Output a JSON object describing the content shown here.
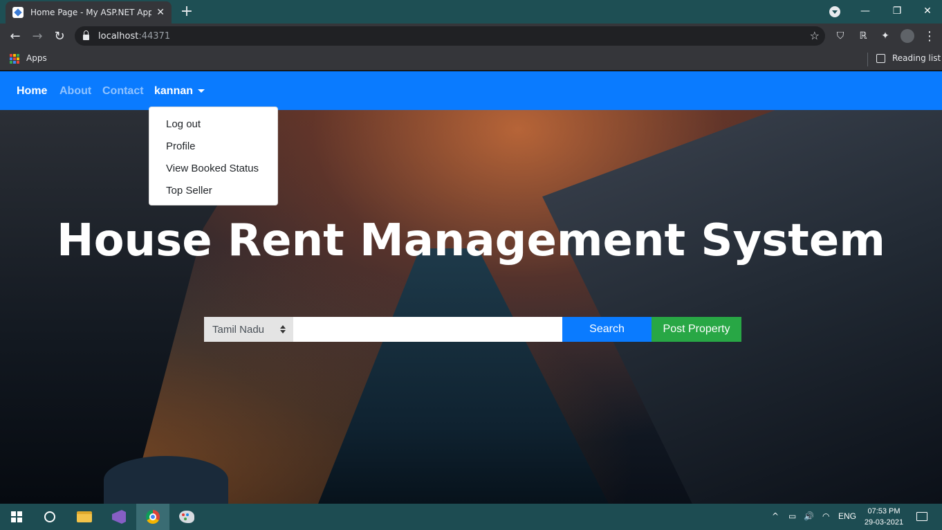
{
  "browser": {
    "tab_title": "Home Page - My ASP.NET Applic",
    "close_glyph": "✕",
    "new_tab_glyph": "+",
    "url_host": "localhost",
    "url_port": ":44371",
    "back_glyph": "←",
    "forward_glyph": "→",
    "reload_glyph": "↻",
    "star_glyph": "☆",
    "menu_glyph": "⋮",
    "min_glyph": "—",
    "restore_glyph": "❐",
    "win_close_glyph": "✕",
    "ext_glyphs": [
      "⛉",
      "ℝ",
      "✦"
    ],
    "bookmarks": {
      "apps_label": "Apps",
      "reading_list_label": "Reading list"
    }
  },
  "site": {
    "nav": {
      "home": "Home",
      "about": "About",
      "contact": "Contact",
      "user": "kannan"
    },
    "user_menu": [
      "Log out",
      "Profile",
      "View Booked Status",
      "Top Seller"
    ],
    "hero_title": "House Rent Management System",
    "search": {
      "state_selected": "Tamil Nadu",
      "input_value": "",
      "search_label": "Search",
      "post_label": "Post Property"
    },
    "colors": {
      "navbar": "#0a7bff",
      "search_btn": "#0a7bff",
      "post_btn": "#28a745"
    }
  },
  "taskbar": {
    "tray": {
      "chevron": "^",
      "battery": "▭",
      "volume": "🔊",
      "wifi": "◠",
      "lang": "ENG"
    },
    "time": "07:53 PM",
    "date": "29-03-2021",
    "apps": [
      "start-icon",
      "cortana-icon",
      "file-explorer-icon",
      "visual-studio-icon",
      "chrome-icon",
      "paint-icon"
    ]
  }
}
